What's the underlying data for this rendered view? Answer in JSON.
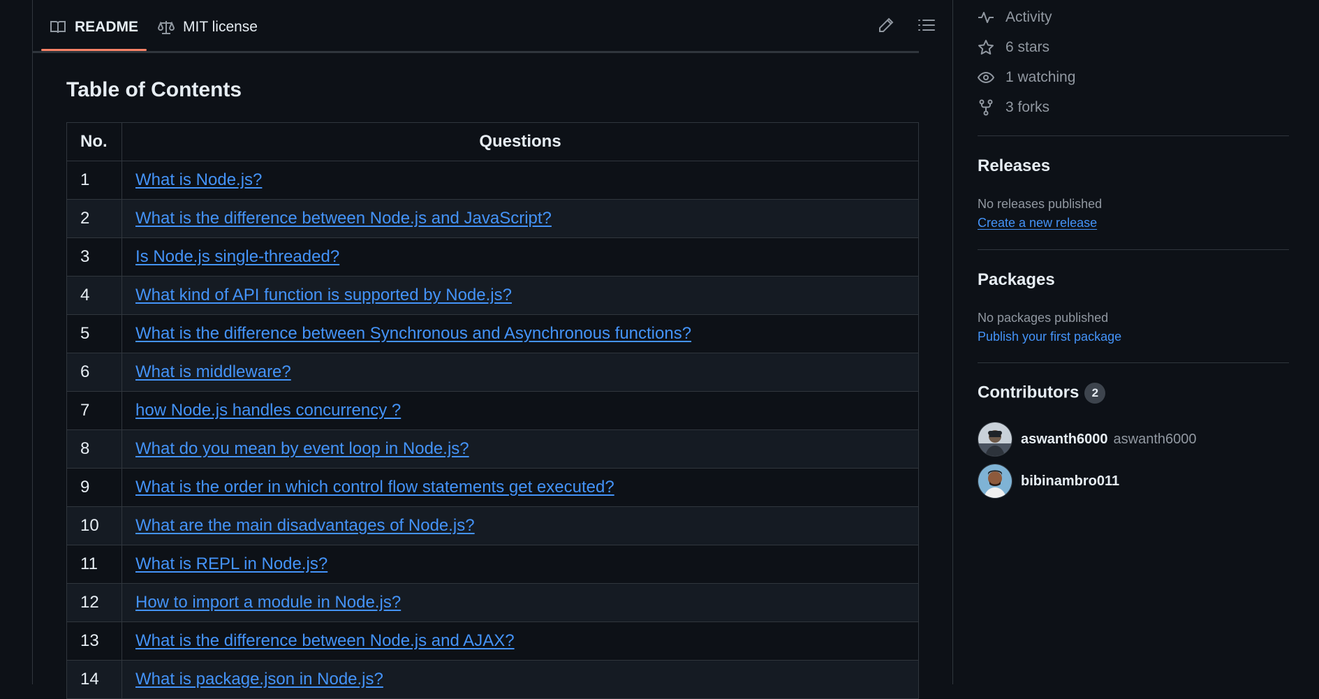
{
  "readme_header": {
    "tabs": [
      {
        "label": "README",
        "icon": "book-icon",
        "active": true
      },
      {
        "label": "MIT license",
        "icon": "law-icon",
        "active": false
      }
    ],
    "actions": [
      "pencil-icon",
      "list-icon"
    ]
  },
  "content": {
    "heading": "Table of Contents",
    "table": {
      "headers": [
        "No.",
        "Questions"
      ],
      "rows": [
        {
          "no": "1",
          "question": "What is Node.js?"
        },
        {
          "no": "2",
          "question": "What is the difference between Node.js and JavaScript?"
        },
        {
          "no": "3",
          "question": "Is Node.js single-threaded?"
        },
        {
          "no": "4",
          "question": "What kind of API function is supported by Node.js?"
        },
        {
          "no": "5",
          "question": "What is the difference between Synchronous and Asynchronous functions?"
        },
        {
          "no": "6",
          "question": "What is middleware?"
        },
        {
          "no": "7",
          "question": "how Node.js handles concurrency ?"
        },
        {
          "no": "8",
          "question": "What do you mean by event loop in Node.js?"
        },
        {
          "no": "9",
          "question": "What is the order in which control flow statements get executed?"
        },
        {
          "no": "10",
          "question": "What are the main disadvantages of Node.js?"
        },
        {
          "no": "11",
          "question": "What is REPL in Node.js?"
        },
        {
          "no": "12",
          "question": "How to import a module in Node.js?"
        },
        {
          "no": "13",
          "question": "What is the difference between Node.js and AJAX?"
        },
        {
          "no": "14",
          "question": "What is package.json in Node.js?"
        }
      ]
    }
  },
  "sidebar": {
    "stats": [
      {
        "label": "Activity",
        "icon": "pulse-icon"
      },
      {
        "label": "6 stars",
        "icon": "star-icon"
      },
      {
        "label": "1 watching",
        "icon": "eye-icon"
      },
      {
        "label": "3 forks",
        "icon": "fork-icon"
      }
    ],
    "releases": {
      "title": "Releases",
      "empty": "No releases published",
      "link": "Create a new release"
    },
    "packages": {
      "title": "Packages",
      "empty": "No packages published",
      "link": "Publish your first package"
    },
    "contributors": {
      "title": "Contributors",
      "count": "2",
      "people": [
        {
          "login": "aswanth6000",
          "name": "aswanth6000"
        },
        {
          "login": "bibinambro011",
          "name": ""
        }
      ]
    }
  },
  "colors": {
    "background": "#0d1117",
    "link": "#4493f8",
    "active_tab_underline": "#f78166",
    "border": "#30363d",
    "muted_text": "#9198a1"
  }
}
